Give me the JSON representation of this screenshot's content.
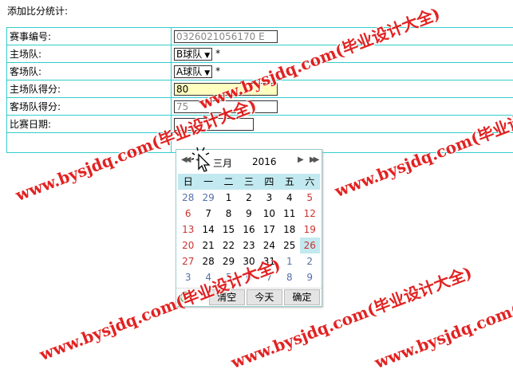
{
  "page": {
    "title": "添加比分统计:"
  },
  "form": {
    "match_no": {
      "label": "赛事编号:",
      "value": "0326021056170 E"
    },
    "home_team": {
      "label": "主场队:",
      "value": "B球队",
      "required": "*"
    },
    "away_team": {
      "label": "客场队:",
      "value": "A球队",
      "required": "*"
    },
    "home_score": {
      "label": "主场队得分:",
      "value": "80"
    },
    "away_score": {
      "label": "客场队得分:",
      "value": "75"
    },
    "match_date": {
      "label": "比赛日期:",
      "value": ""
    }
  },
  "calendar": {
    "month": "三月",
    "year": "2016",
    "weekdays": [
      "日",
      "一",
      "二",
      "三",
      "四",
      "五",
      "六"
    ],
    "weeks": [
      [
        "28",
        "29",
        "1",
        "2",
        "3",
        "4",
        "5"
      ],
      [
        "6",
        "7",
        "8",
        "9",
        "10",
        "11",
        "12"
      ],
      [
        "13",
        "14",
        "15",
        "16",
        "17",
        "18",
        "19"
      ],
      [
        "20",
        "21",
        "22",
        "23",
        "24",
        "25",
        "26"
      ],
      [
        "27",
        "28",
        "29",
        "30",
        "31",
        "1",
        "2"
      ],
      [
        "3",
        "4",
        "5",
        "6",
        "7",
        "8",
        "9"
      ]
    ],
    "buttons": {
      "clear": "清空",
      "today": "今天",
      "ok": "确定"
    }
  },
  "watermark": "www.bysjdq.com(毕业设计大全)",
  "colors": {
    "border": "#33cccc",
    "highlight": "#ffffc0",
    "calendar_header": "#c2e9ef",
    "watermark": "#e01010"
  }
}
